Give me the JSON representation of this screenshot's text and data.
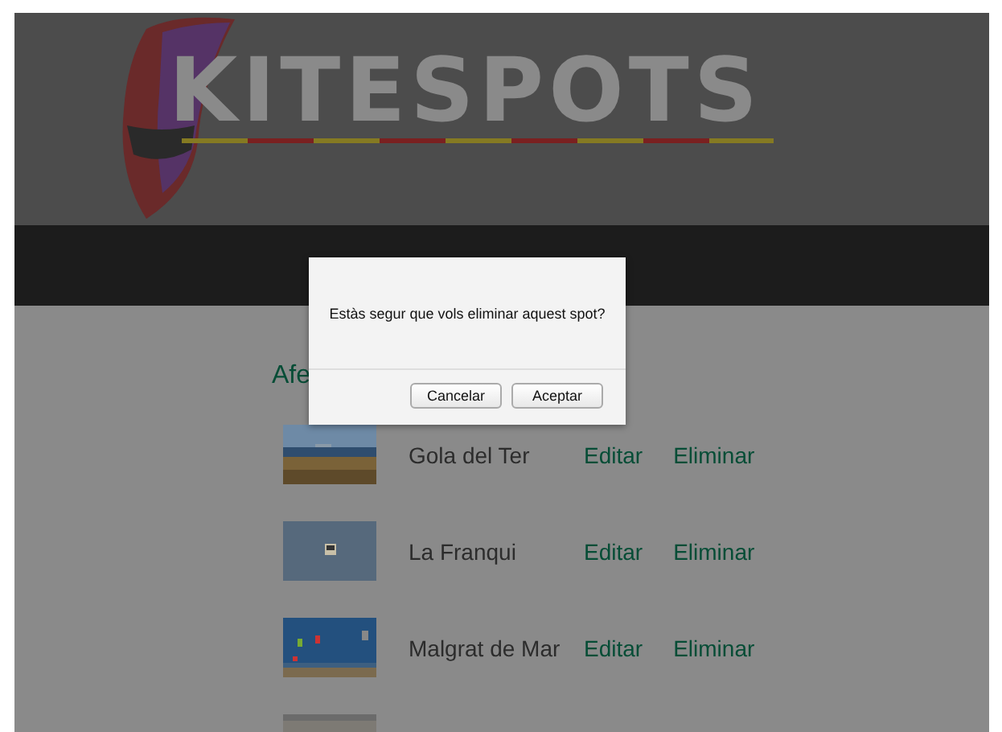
{
  "header": {
    "logo": "KITESPOTS"
  },
  "section_title": "Afe",
  "spots": [
    {
      "name": "Gola del Ter",
      "kind": "picture",
      "actions": [
        "Editar",
        "Eliminar"
      ]
    },
    {
      "name": "La Franqui",
      "kind": "picture",
      "actions": [
        "Editar",
        "Eliminar"
      ]
    },
    {
      "name": "Malgrat de Mar",
      "kind": "picture",
      "actions": [
        "Editar",
        "Eliminar"
      ]
    },
    {
      "kind": "picture"
    }
  ],
  "dialog": {
    "message": "Estàs segur que vols eliminar aquest spot?",
    "buttons": [
      "Cancelar",
      "Aceptar"
    ]
  }
}
